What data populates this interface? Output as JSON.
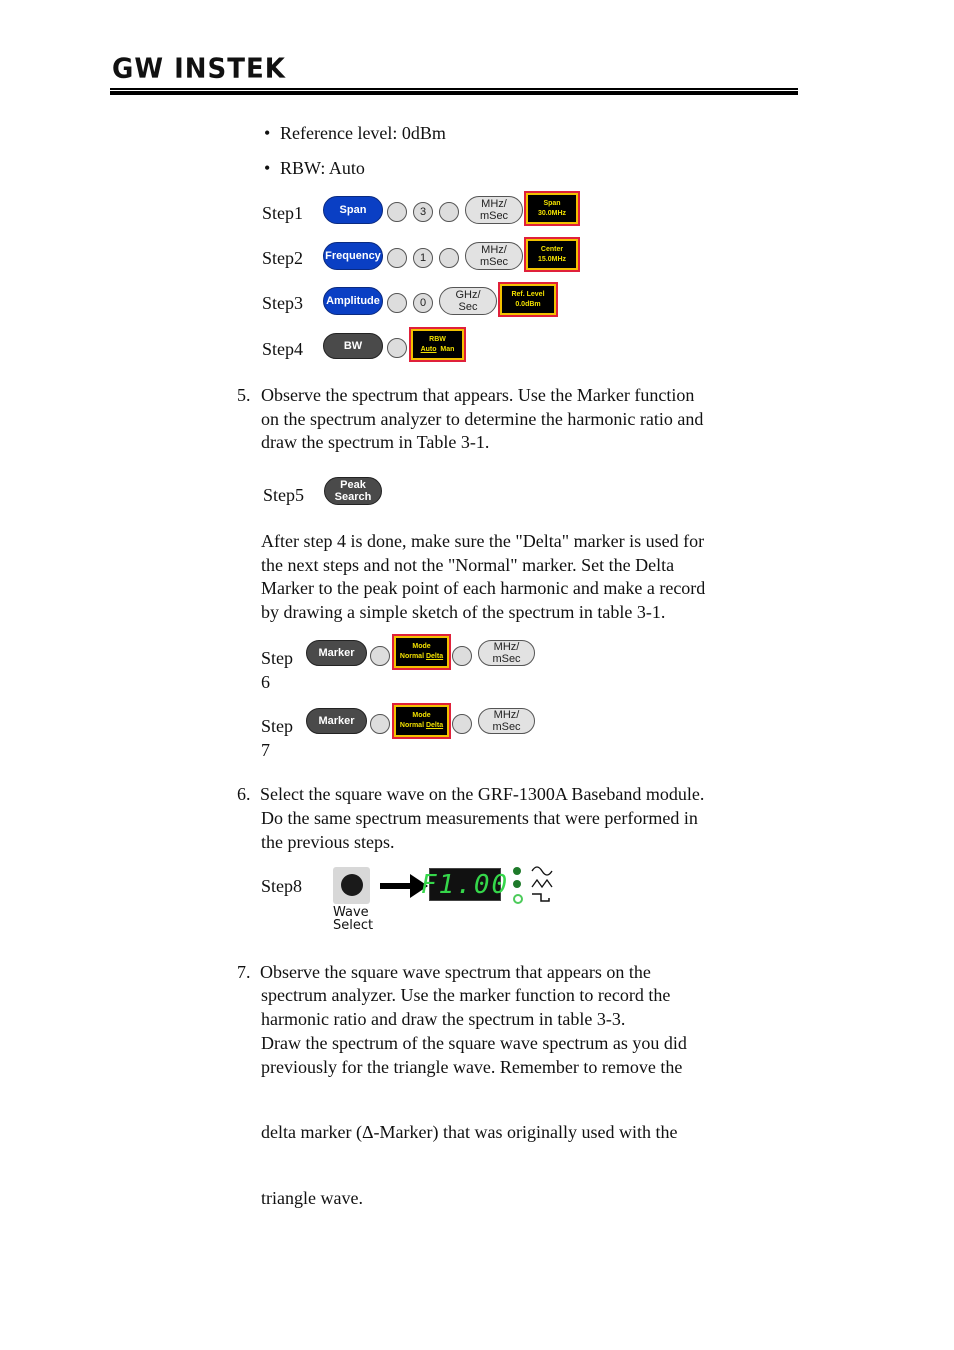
{
  "header": {
    "logo": "GW INSTEK"
  },
  "bullets": [
    "Reference level: 0dBm",
    "RBW: Auto"
  ],
  "steps": [
    {
      "label": "Step1",
      "key": "Span",
      "digit": "3",
      "unit": "MHz/\nmSec",
      "screen": [
        "Span",
        "30.0MHz"
      ]
    },
    {
      "label": "Step2",
      "key": "Frequency",
      "digit": "1",
      "unit": "MHz/\nmSec",
      "screen": [
        "Center",
        "15.0MHz"
      ]
    },
    {
      "label": "Step3",
      "key": "Amplitude",
      "digit": "0",
      "unit": "GHz/\nSec",
      "screen": [
        "Ref. Level",
        "0.0dBm"
      ]
    },
    {
      "label": "Step4",
      "key": "BW",
      "screen": [
        "RBW",
        "Auto",
        "Man"
      ]
    },
    {
      "label": "Step5",
      "key": "Peak Search"
    },
    {
      "label": "Step 6",
      "key": "Marker",
      "screen": [
        "Mode",
        "Normal",
        "Delta"
      ],
      "unit": "MHz/\nmSec"
    },
    {
      "label": "Step 7",
      "key": "Marker",
      "screen": [
        "Mode",
        "Normal",
        "Delta"
      ],
      "unit": "MHz/\nmSec"
    },
    {
      "label": "Step8",
      "button": "Wave Select",
      "display": "F1.00",
      "waves": [
        "sine",
        "triangle",
        "square"
      ]
    }
  ],
  "para5": {
    "num": "5.",
    "lines": [
      "Observe the spectrum that appears. Use the Marker function",
      "on the spectrum analyzer to determine the harmonic ratio and",
      "draw the spectrum in Table 3-1."
    ]
  },
  "para_after5": {
    "lines": [
      "After step 4 is done, make sure the \"Delta\" marker is used for",
      "the next steps and not the \"Normal\" marker. Set the Delta",
      "Marker to the peak point of each harmonic and make a record",
      "by drawing a simple sketch of the spectrum in table 3-1."
    ]
  },
  "para6": {
    "num": "6.",
    "lines": [
      "Select the square wave on the GRF-1300A Baseband module.",
      "Do the same spectrum measurements that were performed in",
      "the previous steps."
    ]
  },
  "para7": {
    "num": "7.",
    "lines": [
      "Observe the square wave spectrum that appears on the",
      "spectrum analyzer. Use the marker function to record the",
      "harmonic ratio and draw the spectrum in table 3-3.",
      "Draw the spectrum of the square wave spectrum as you did",
      "previously for the triangle wave. Remember to remove the",
      "delta marker (Δ-Marker) that was originally used with the",
      "triangle wave."
    ]
  },
  "colors": {
    "blue_key": "#0a3fc4",
    "dark_key": "#4a4a4a",
    "screen_text": "#f2e000",
    "led": "#35d64a"
  }
}
